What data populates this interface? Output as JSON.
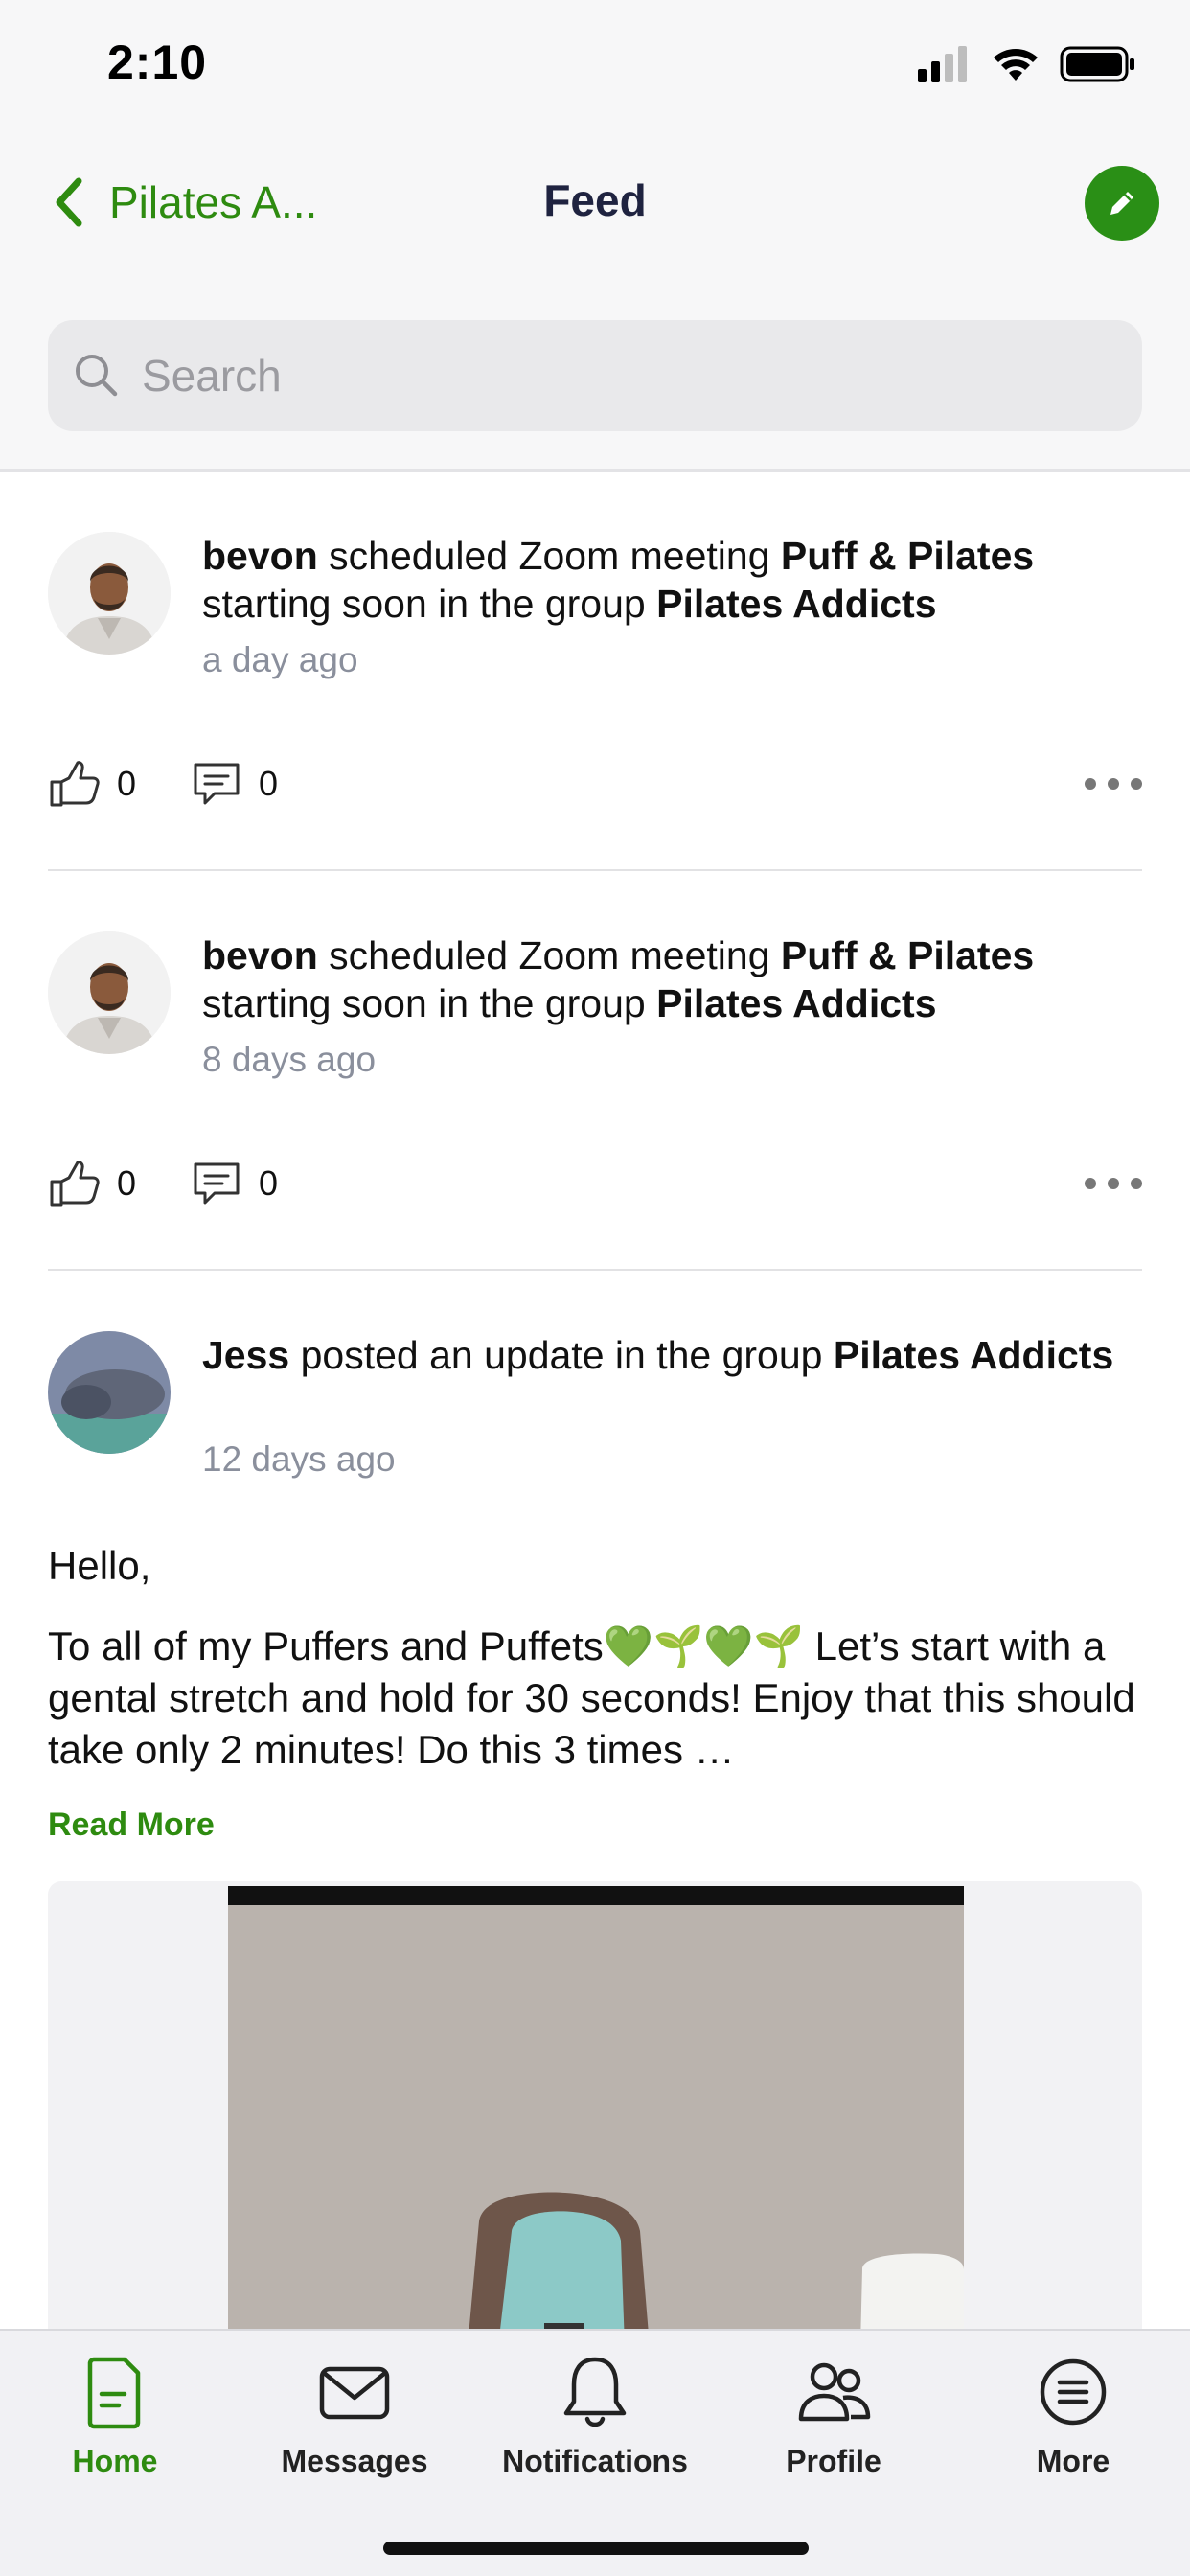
{
  "status_bar": {
    "time": "2:10"
  },
  "header": {
    "back_label": "Pilates A...",
    "title": "Feed",
    "accent_color": "#2e8b10"
  },
  "search": {
    "placeholder": "Search"
  },
  "feed": {
    "posts": [
      {
        "user": "bevon",
        "action": " scheduled Zoom meeting ",
        "subject": "Puff & Pilates",
        "action2": " starting soon in the group ",
        "group": "Pilates Addicts",
        "time": "a day ago",
        "likes": "0",
        "comments": "0"
      },
      {
        "user": "bevon",
        "action": " scheduled Zoom meeting ",
        "subject": "Puff & Pilates",
        "action2": " starting soon in the group ",
        "group": "Pilates Addicts",
        "time": "8 days ago",
        "likes": "0",
        "comments": "0"
      },
      {
        "user": "Jess",
        "action": " posted an update in the group ",
        "group": "Pilates Addicts",
        "time": "12 days ago",
        "greeting": "Hello,",
        "body": "To all of my Puffers and Puffets💚🌱💚🌱 Let’s start with a gental stretch and hold for 30 seconds! Enjoy that this should take only 2 minutes! Do this 3 times …",
        "read_more": "Read More"
      }
    ]
  },
  "tabbar": {
    "items": [
      {
        "label": "Home",
        "icon": "home-document-icon",
        "active": true
      },
      {
        "label": "Messages",
        "icon": "envelope-icon",
        "active": false
      },
      {
        "label": "Notifications",
        "icon": "bell-icon",
        "active": false
      },
      {
        "label": "Profile",
        "icon": "people-icon",
        "active": false
      },
      {
        "label": "More",
        "icon": "list-circle-icon",
        "active": false
      }
    ]
  }
}
